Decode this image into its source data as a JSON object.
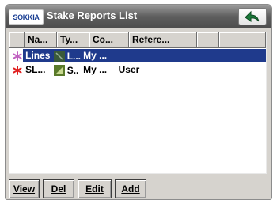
{
  "window": {
    "logo_text": "SOKKIA",
    "title": "Stake Reports List"
  },
  "colors": {
    "titlebar": "#5e5e5e",
    "selection": "#1f3a8c",
    "star_red": "#e02020",
    "star_selected": "#c060c0"
  },
  "table": {
    "columns": [
      {
        "label": ""
      },
      {
        "label": "Na..."
      },
      {
        "label": "Ty..."
      },
      {
        "label": "Co..."
      },
      {
        "label": "Refere..."
      },
      {
        "label": ""
      },
      {
        "label": ""
      }
    ],
    "rows": [
      {
        "selected": true,
        "marker_icon": "asterisk-icon",
        "name": "Lines",
        "type_icon": "line-type-icon",
        "type": "L...",
        "code": "My ...",
        "reference": ""
      },
      {
        "selected": false,
        "marker_icon": "asterisk-icon",
        "name": "SL...",
        "type_icon": "slope-type-icon",
        "type": "S..",
        "code": "My ...",
        "reference": "User"
      }
    ]
  },
  "buttons": {
    "view": "View",
    "del": "Del",
    "edit": "Edit",
    "add": "Add"
  },
  "icons": {
    "back": "back-arrow-icon"
  }
}
